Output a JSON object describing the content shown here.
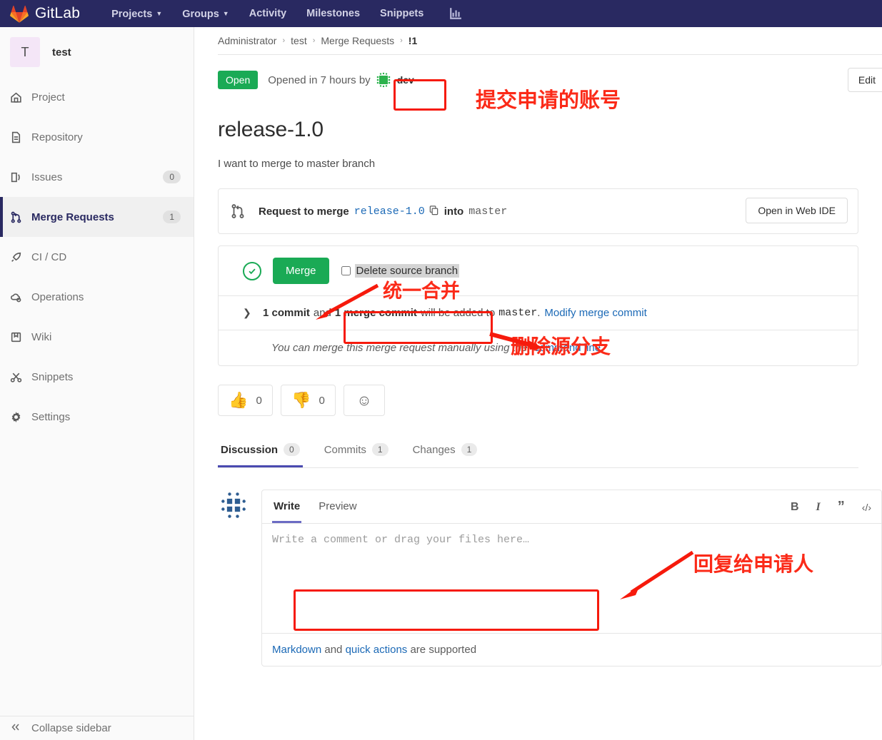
{
  "navbar": {
    "brand": "GitLab",
    "links": [
      {
        "label": "Projects",
        "caret": true,
        "name": "nav-projects"
      },
      {
        "label": "Groups",
        "caret": true,
        "name": "nav-groups"
      },
      {
        "label": "Activity",
        "caret": false,
        "name": "nav-activity"
      },
      {
        "label": "Milestones",
        "caret": false,
        "name": "nav-milestones"
      },
      {
        "label": "Snippets",
        "caret": false,
        "name": "nav-snippets"
      }
    ],
    "chart_icon": "analytics-chart-icon"
  },
  "sidebar": {
    "project_initial": "T",
    "project_name": "test",
    "items": [
      {
        "label": "Project",
        "icon": "home-icon",
        "count": "",
        "active": false
      },
      {
        "label": "Repository",
        "icon": "document-icon",
        "count": "",
        "active": false
      },
      {
        "label": "Issues",
        "icon": "issues-icon",
        "count": "0",
        "active": false
      },
      {
        "label": "Merge Requests",
        "icon": "merge-icon",
        "count": "1",
        "active": true
      },
      {
        "label": "CI / CD",
        "icon": "rocket-icon",
        "count": "",
        "active": false
      },
      {
        "label": "Operations",
        "icon": "cloud-gear-icon",
        "count": "",
        "active": false
      },
      {
        "label": "Wiki",
        "icon": "book-icon",
        "count": "",
        "active": false
      },
      {
        "label": "Snippets",
        "icon": "scissors-icon",
        "count": "",
        "active": false
      },
      {
        "label": "Settings",
        "icon": "gear-icon",
        "count": "",
        "active": false
      }
    ],
    "collapse_label": "Collapse sidebar",
    "collapse_icon": "double-chevron-left-icon"
  },
  "breadcrumb": {
    "items": [
      "Administrator",
      "test",
      "Merge Requests"
    ],
    "current": "!1",
    "separator": "›"
  },
  "status": {
    "badge": "Open",
    "opened_text": "Opened in 7 hours by",
    "author": "dev",
    "author_avatar": "identicon-green",
    "edit_label": "Edit"
  },
  "mr": {
    "title": "release-1.0",
    "description": "I want to merge to master branch"
  },
  "widget": {
    "branch_icon": "merge-request-icon",
    "request_label": "Request to merge",
    "source_branch": "release-1.0",
    "copy_icon": "copy-icon",
    "into_label": "into",
    "target_branch": "master",
    "web_ide_label": "Open in Web IDE"
  },
  "merge_panel": {
    "status_icon": "check-circle-icon",
    "merge_button": "Merge",
    "delete_source_branch_label": "Delete source branch",
    "delete_source_branch_checked": false,
    "chevron_icon": "chevron-right-icon",
    "commit_count": "1 commit",
    "and_label": "and",
    "merge_commit_count": "1 merge commit",
    "will_be_added": "will be added to",
    "target_branch": "master",
    "period": ".",
    "modify_link": "Modify merge commit",
    "manual_prefix": "You can merge this merge request manually using the",
    "manual_link": "command line"
  },
  "awards": [
    {
      "emoji": "👍",
      "count": "0",
      "name": "thumbsup-award"
    },
    {
      "emoji": "👎",
      "count": "0",
      "name": "thumbsdown-award"
    },
    {
      "emoji": "☺",
      "count": "",
      "name": "add-reaction-button"
    }
  ],
  "tabs": [
    {
      "label": "Discussion",
      "count": "0",
      "active": true
    },
    {
      "label": "Commits",
      "count": "1",
      "active": false
    },
    {
      "label": "Changes",
      "count": "1",
      "active": false
    }
  ],
  "note": {
    "avatar": "identicon-blue",
    "tabs": [
      {
        "label": "Write",
        "active": true
      },
      {
        "label": "Preview",
        "active": false
      }
    ],
    "toolbar": [
      {
        "glyph": "B",
        "name": "bold-icon"
      },
      {
        "glyph": "I",
        "name": "italic-icon"
      },
      {
        "glyph": "”",
        "name": "quote-icon"
      },
      {
        "glyph": "‹/›",
        "name": "code-icon"
      }
    ],
    "placeholder": "Write a comment or drag your files here…",
    "value": "",
    "footer_markdown": "Markdown",
    "footer_and": "and",
    "footer_quick": "quick actions",
    "footer_tail": "are supported"
  },
  "annotations": {
    "color": "#fb2a18",
    "items": [
      {
        "text": "提交申请的账号",
        "meaning": "account that submitted the request"
      },
      {
        "text": "统一合并",
        "meaning": "unified merge"
      },
      {
        "text": "删除源分支",
        "meaning": "delete source branch"
      },
      {
        "text": "回复给申请人",
        "meaning": "reply to the requester"
      }
    ]
  }
}
